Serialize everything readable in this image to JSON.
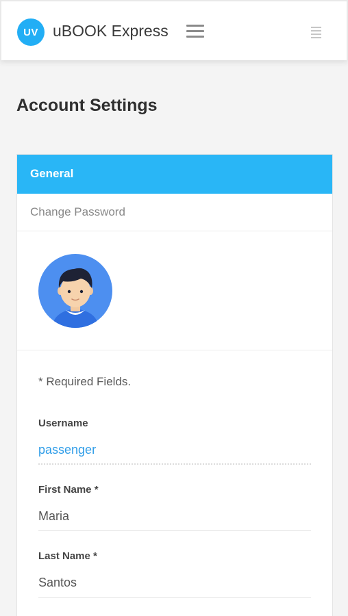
{
  "header": {
    "logo_text": "UV",
    "app_title": "uBOOK Express",
    "menu_icon": "hamburger-menu-icon",
    "secondary_menu_icon": "list-menu-icon"
  },
  "page": {
    "title": "Account Settings"
  },
  "tabs": [
    {
      "label": "General",
      "active": true
    },
    {
      "label": "Change Password",
      "active": false
    }
  ],
  "profile": {
    "avatar_icon": "user-avatar-icon"
  },
  "form": {
    "required_note": "* Required Fields.",
    "username": {
      "label": "Username",
      "value": "passenger"
    },
    "first_name": {
      "label": "First Name *",
      "value": "Maria"
    },
    "last_name": {
      "label": "Last Name *",
      "value": "Santos"
    }
  },
  "colors": {
    "accent": "#29b6f6",
    "link": "#2f9de8",
    "avatar_bg": "#4d8ff0"
  }
}
